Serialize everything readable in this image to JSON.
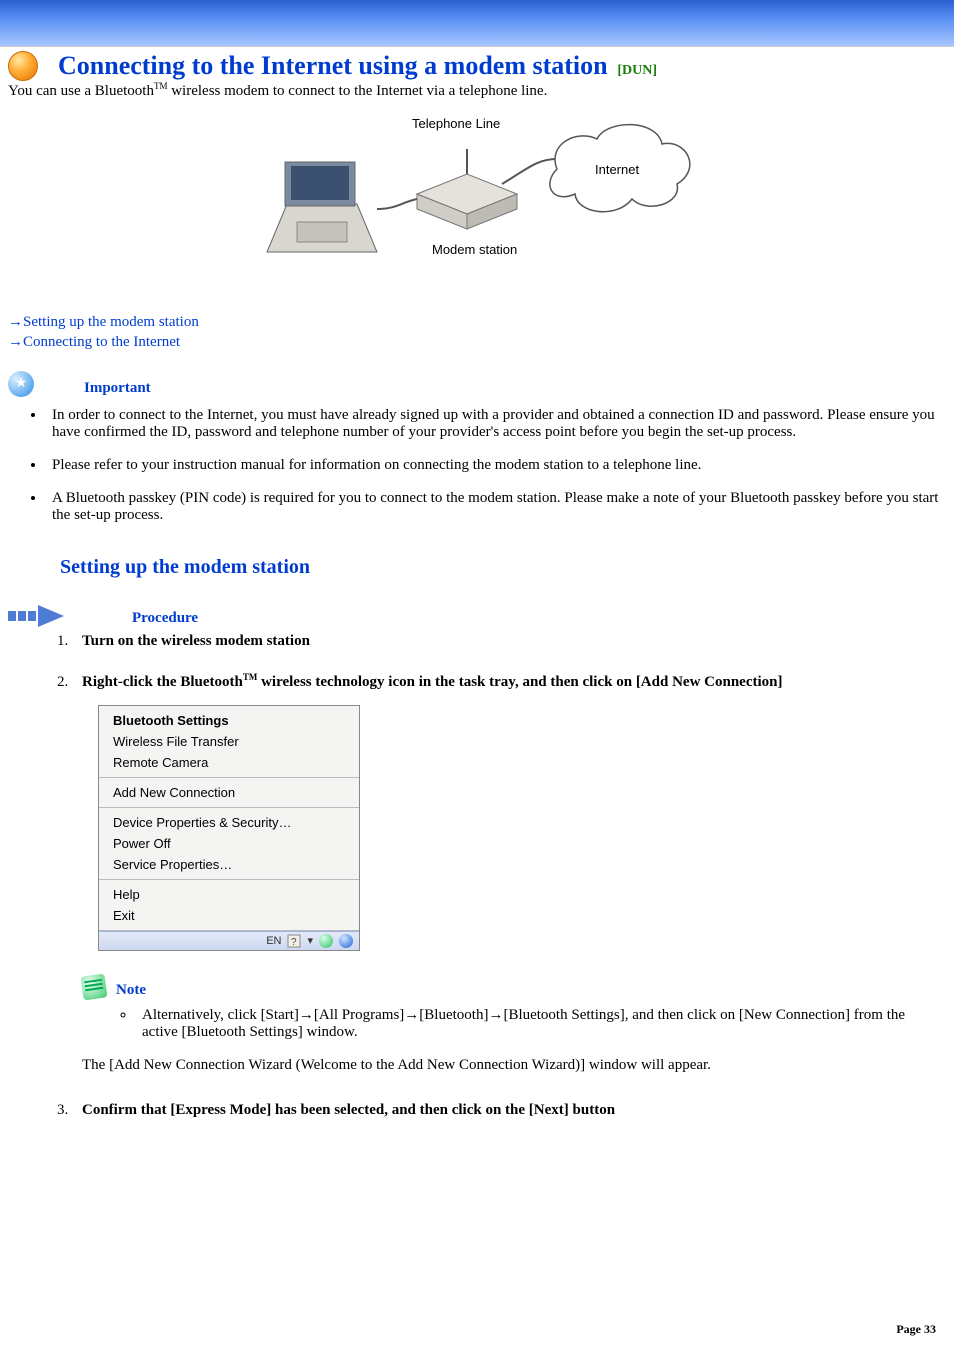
{
  "header": {
    "title": "Connecting to the Internet using a modem station",
    "tag": "[DUN]"
  },
  "intro": {
    "prefix": "You can use a Bluetooth",
    "tm": "TM",
    "suffix": " wireless modem to connect to the Internet via a telephone line."
  },
  "diagram": {
    "telephone_line": "Telephone Line",
    "internet": "Internet",
    "modem_station": "Modem station"
  },
  "links": {
    "arrow": "→",
    "l1": "Setting up the modem station",
    "l2": "Connecting to the Internet"
  },
  "important": {
    "label": "Important",
    "items": [
      "In order to connect to the Internet, you must have already signed up with a provider and obtained a connection ID and password. Please ensure you have confirmed the ID, password and telephone number of your provider's access point before you begin the set-up process.",
      "Please refer to your instruction manual for information on connecting the modem station to a telephone line.",
      "A Bluetooth passkey (PIN code) is required for you to connect to the modem station. Please make a note of your Bluetooth passkey before you start the set-up process."
    ]
  },
  "section2_title": "Setting up the modem station",
  "procedure": {
    "label": "Procedure",
    "step1": "Turn on the wireless modem station",
    "step2_prefix": "Right-click the Bluetooth",
    "step2_tm": "TM",
    "step2_suffix": " wireless technology icon in the task tray, and then click on [Add New Connection]",
    "step3": "Confirm that [Express Mode] has been selected, and then click on the [Next] button"
  },
  "context_menu": {
    "g1": [
      "Bluetooth Settings",
      "Wireless File Transfer",
      "Remote Camera"
    ],
    "g2": [
      "Add New Connection"
    ],
    "g3": [
      "Device Properties & Security…",
      "Power Off",
      "Service Properties…"
    ],
    "g4": [
      "Help",
      "Exit"
    ],
    "tray_lang": "EN"
  },
  "note": {
    "label": "Note",
    "items": [
      "Alternatively, click [Start]→[All Programs]→[Bluetooth]→[Bluetooth Settings], and then click on [New Connection] from the active [Bluetooth Settings] window."
    ]
  },
  "after_note": "The [Add New Connection Wizard (Welcome to the Add New Connection Wizard)] window will appear.",
  "page_label": "Page 33"
}
